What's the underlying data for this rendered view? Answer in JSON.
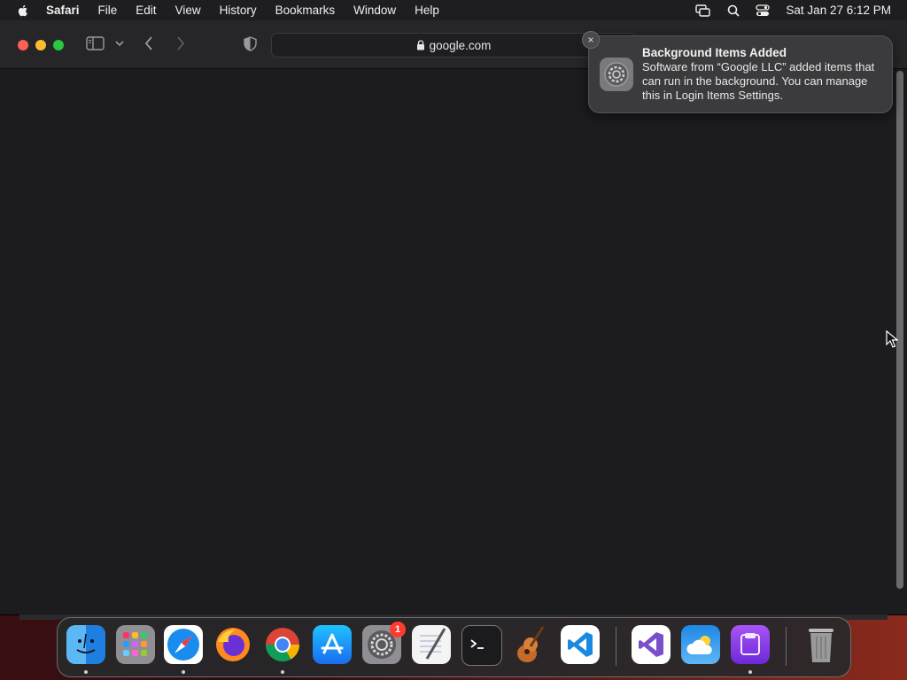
{
  "menubar": {
    "app_name": "Safari",
    "items": [
      "File",
      "Edit",
      "View",
      "History",
      "Bookmarks",
      "Window",
      "Help"
    ],
    "clock": "Sat Jan 27  6:12 PM",
    "icons": [
      "screen-mirroring-icon",
      "spotlight-search-icon",
      "control-center-icon"
    ]
  },
  "toolbar": {
    "address": "google.com"
  },
  "notification": {
    "title": "Background Items Added",
    "body": "Software from “Google LLC” added items that can run in the background. You can manage this in Login Items Settings.",
    "close_label": "×"
  },
  "dock": {
    "apps": [
      {
        "name": "Finder",
        "icon": "finder-icon",
        "running": true
      },
      {
        "name": "Launchpad",
        "icon": "launchpad-icon",
        "running": false
      },
      {
        "name": "Safari",
        "icon": "safari-icon",
        "running": true
      },
      {
        "name": "Firefox",
        "icon": "firefox-icon",
        "running": false
      },
      {
        "name": "Google Chrome",
        "icon": "chrome-icon",
        "running": true
      },
      {
        "name": "App Store",
        "icon": "app-store-icon",
        "running": false
      },
      {
        "name": "System Settings",
        "icon": "system-settings-icon",
        "running": false,
        "badge": "1"
      },
      {
        "name": "TextEdit",
        "icon": "textedit-icon",
        "running": false
      },
      {
        "name": "Terminal",
        "icon": "terminal-icon",
        "running": false
      },
      {
        "name": "GarageBand",
        "icon": "garageband-icon",
        "running": false
      },
      {
        "name": "Visual Studio Code",
        "icon": "vscode-icon",
        "running": false
      },
      {
        "name": "Visual Studio",
        "icon": "visual-studio-icon",
        "running": false
      },
      {
        "name": "Weather",
        "icon": "weather-icon",
        "running": false
      },
      {
        "name": "Apple Configurator",
        "icon": "configurator-icon",
        "running": true
      },
      {
        "name": "Trash",
        "icon": "trash-icon",
        "running": false
      }
    ]
  },
  "colors": {
    "close": "#fe5f57",
    "minimize": "#febc2e",
    "zoom": "#28c840",
    "badge": "#ff3b30"
  }
}
